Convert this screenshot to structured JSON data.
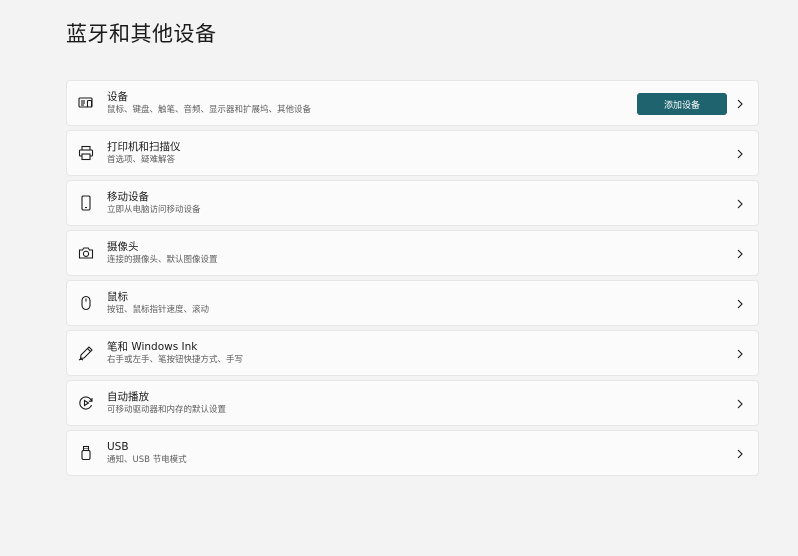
{
  "page": {
    "title": "蓝牙和其他设备"
  },
  "items": [
    {
      "title": "设备",
      "subtitle": "鼠标、键盘、触笔、音频、显示器和扩展坞、其他设备",
      "icon": "devices-icon",
      "button_label": "添加设备"
    },
    {
      "title": "打印机和扫描仪",
      "subtitle": "首选项、疑难解答",
      "icon": "printer-icon"
    },
    {
      "title": "移动设备",
      "subtitle": "立即从电脑访问移动设备",
      "icon": "phone-icon"
    },
    {
      "title": "摄像头",
      "subtitle": "连接的摄像头、默认图像设置",
      "icon": "camera-icon"
    },
    {
      "title": "鼠标",
      "subtitle": "按钮、鼠标指针速度、滚动",
      "icon": "mouse-icon"
    },
    {
      "title": "笔和 Windows Ink",
      "subtitle": "右手或左手、笔按钮快捷方式、手写",
      "icon": "pen-icon"
    },
    {
      "title": "自动播放",
      "subtitle": "可移动驱动器和内存的默认设置",
      "icon": "autoplay-icon"
    },
    {
      "title": "USB",
      "subtitle": "通知、USB 节电模式",
      "icon": "usb-icon"
    }
  ],
  "colors": {
    "accent": "#1e636e",
    "background": "#f3f3f3",
    "card": "#fbfbfb"
  }
}
